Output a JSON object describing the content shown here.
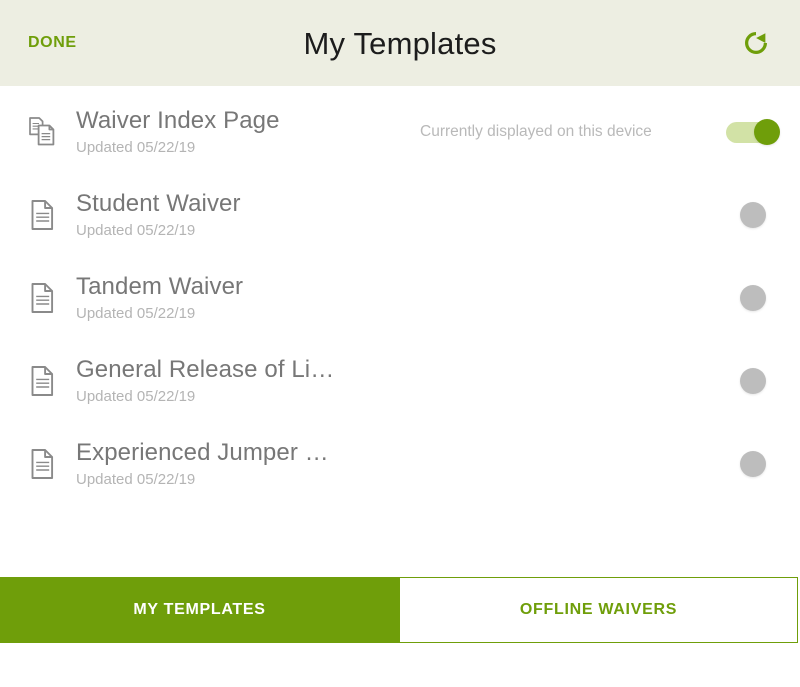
{
  "header": {
    "done_label": "DONE",
    "title": "My Templates",
    "refresh_icon": "refresh-icon"
  },
  "colors": {
    "accent_green": "#6F9E0A",
    "track_green": "#D2E2A6",
    "header_bg": "#EDEEE2",
    "title_grey": "#777777",
    "subtitle_grey": "#B4B4B4",
    "status_grey": "#B9B9B9",
    "toggle_off_grey": "#BDBDBD"
  },
  "list": {
    "items": [
      {
        "icon": "documents-copy-icon",
        "title": "Waiver Index Page",
        "subtitle": "Updated 05/22/19",
        "status": "Currently displayed on this device",
        "toggle_state": "on"
      },
      {
        "icon": "document-icon",
        "title": "Student Waiver",
        "subtitle": "Updated 05/22/19",
        "status": "",
        "toggle_state": "off"
      },
      {
        "icon": "document-icon",
        "title": "Tandem Waiver",
        "subtitle": "Updated 05/22/19",
        "status": "",
        "toggle_state": "off"
      },
      {
        "icon": "document-icon",
        "title": "General Release of Li…",
        "subtitle": "Updated 05/22/19",
        "status": "",
        "toggle_state": "off"
      },
      {
        "icon": "document-icon",
        "title": "Experienced Jumper …",
        "subtitle": "Updated 05/22/19",
        "status": "",
        "toggle_state": "off"
      }
    ]
  },
  "tabs": [
    {
      "label": "MY TEMPLATES",
      "state": "active"
    },
    {
      "label": "OFFLINE WAIVERS",
      "state": "inactive"
    }
  ]
}
